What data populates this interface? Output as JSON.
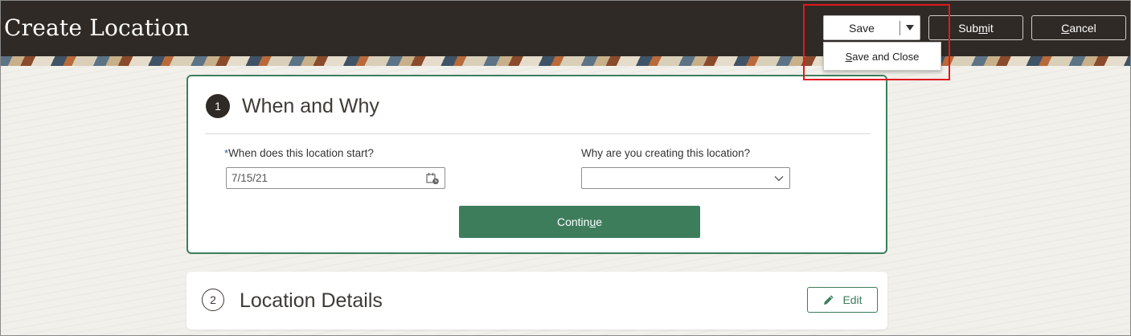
{
  "header": {
    "title": "Create Location",
    "save_label": "Save",
    "submit_label": "Submit",
    "cancel_label": "Cancel"
  },
  "save_menu": {
    "items": [
      {
        "label": "Save and Close"
      }
    ]
  },
  "section1": {
    "number": "1",
    "title": "When and Why",
    "start_date": {
      "required_marker": "*",
      "label": "When does this location start?",
      "value": "7/15/21"
    },
    "reason": {
      "label": "Why are you creating this location?",
      "value": ""
    },
    "continue_label": "Continue"
  },
  "section2": {
    "number": "2",
    "title": "Location Details",
    "edit_label": "Edit"
  },
  "colors": {
    "header_bg": "#2f2a25",
    "accent_green": "#3d7d5c",
    "highlight_red": "#e0191f"
  },
  "icons": [
    "caret-down-icon",
    "calendar-icon",
    "chevron-down-icon",
    "pencil-icon"
  ]
}
